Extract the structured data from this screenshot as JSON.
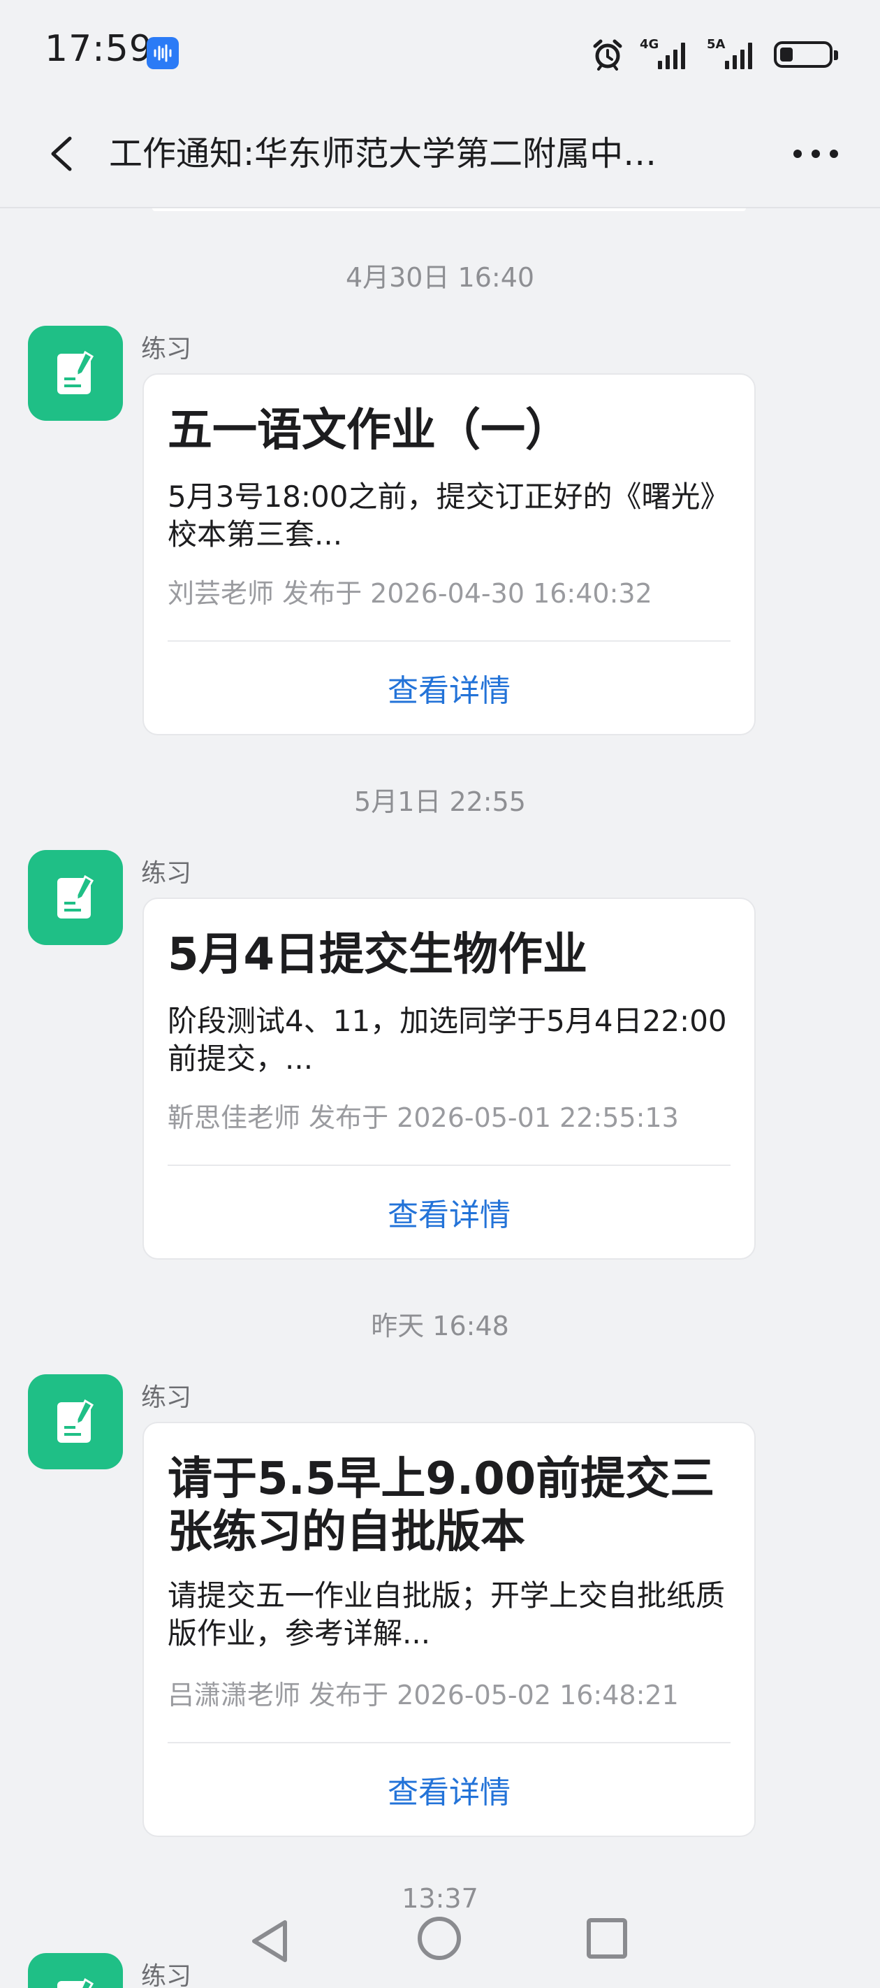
{
  "status_bar": {
    "time": "17:59",
    "network_1": "4G",
    "network_2": "5A"
  },
  "header": {
    "title": "工作通知:华东师范大学第二附属中…"
  },
  "messages": [
    {
      "timestamp": "4月30日 16:40",
      "sender": "练习",
      "title": "五一语文作业（一）",
      "description": "5月3号18:00之前，提交订正好的《曙光》校本第三套...",
      "meta": "刘芸老师 发布于 2026-04-30 16:40:32",
      "action": "查看详情"
    },
    {
      "timestamp": "5月1日 22:55",
      "sender": "练习",
      "title": "5月4日提交生物作业",
      "description": "阶段测试4、11，加选同学于5月4日22:00前提交，...",
      "meta": "靳思佳老师 发布于 2026-05-01 22:55:13",
      "action": "查看详情"
    },
    {
      "timestamp": "昨天 16:48",
      "sender": "练习",
      "title": "请于5.5早上9.00前提交三张练习的自批版本",
      "description": "请提交五一作业自批版；开学上交自批纸质版作业，参考详解...",
      "meta": "吕潇潇老师 发布于 2026-05-02 16:48:21",
      "action": "查看详情"
    },
    {
      "timestamp": "13:37",
      "sender": "练习"
    }
  ],
  "colors": {
    "accent_green": "#1fbf86",
    "link_blue": "#2373d8",
    "background": "#f1f2f4"
  },
  "icons": {
    "app": "document-pen-icon",
    "back": "chevron-left-icon",
    "more": "more-dots-icon"
  }
}
